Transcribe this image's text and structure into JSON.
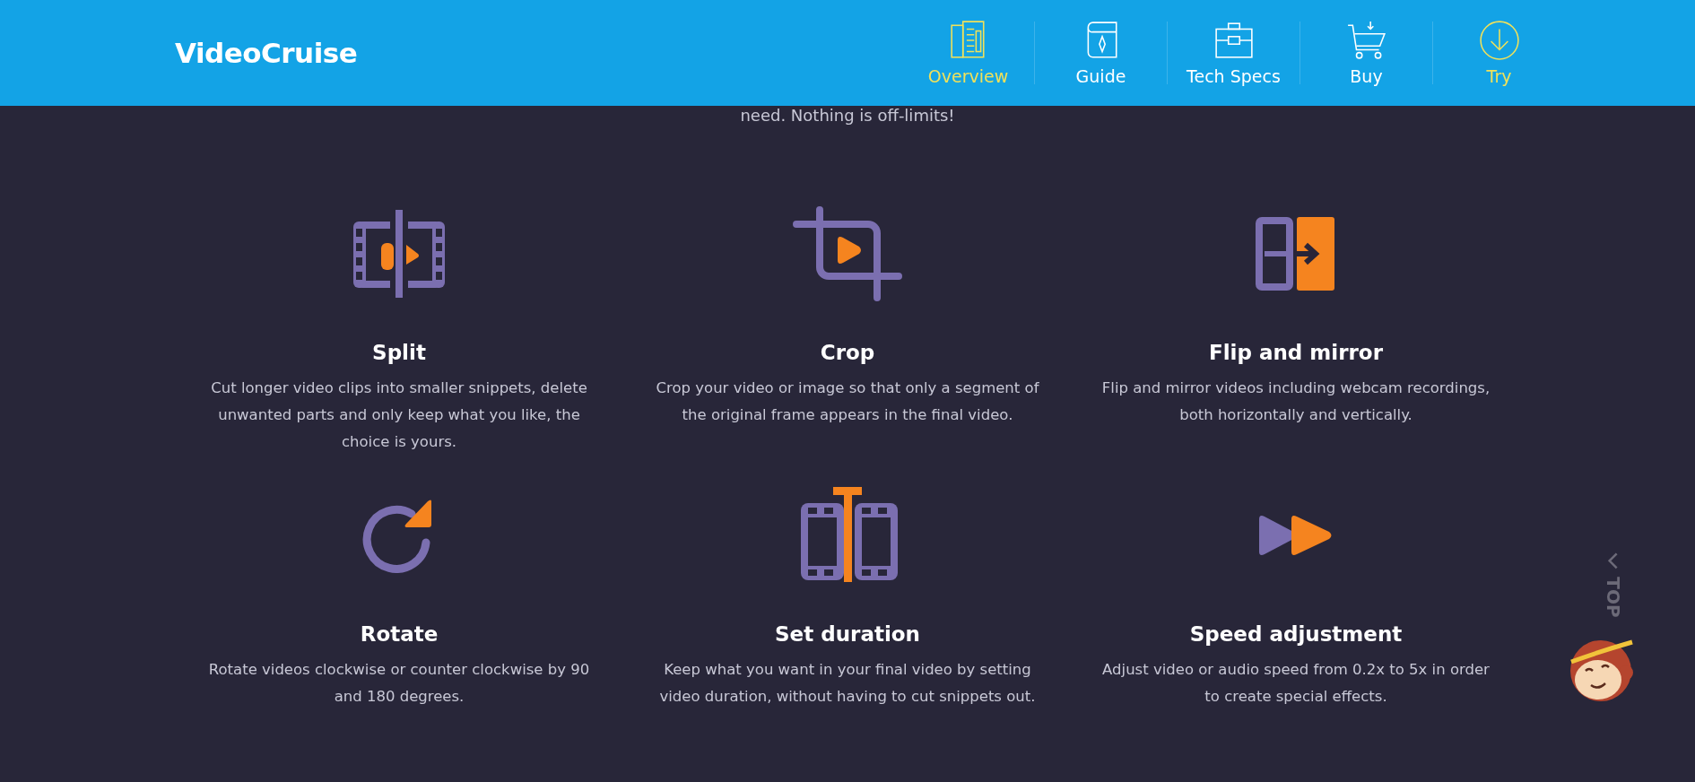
{
  "header": {
    "logo": "VideoCruise",
    "nav": [
      {
        "label": "Overview",
        "kind": "overview",
        "highlighted": true
      },
      {
        "label": "Guide",
        "kind": "guide",
        "highlighted": false
      },
      {
        "label": "Tech Specs",
        "kind": "specs",
        "highlighted": false
      },
      {
        "label": "Buy",
        "kind": "buy",
        "highlighted": false
      },
      {
        "label": "Try",
        "kind": "try",
        "highlighted": true
      }
    ]
  },
  "intro_tail": "need. Nothing is off-limits!",
  "features": [
    {
      "kind": "split",
      "title": "Split",
      "description": "Cut longer video clips into smaller snippets, delete unwanted parts and only keep what you like, the choice is yours."
    },
    {
      "kind": "crop",
      "title": "Crop",
      "description": "Crop your video or image so that only a segment of the original frame appears in the final video."
    },
    {
      "kind": "flip",
      "title": "Flip and mirror",
      "description": "Flip and mirror videos including webcam recordings, both horizontally and vertically."
    },
    {
      "kind": "rotate",
      "title": "Rotate",
      "description": "Rotate videos clockwise or counter clockwise by 90 and 180 degrees."
    },
    {
      "kind": "duration",
      "title": "Set duration",
      "description": "Keep what you want in your final video by setting video duration, without having to cut snippets out."
    },
    {
      "kind": "speed",
      "title": "Speed adjustment",
      "description": "Adjust video or audio speed from 0.2x to 5x in order to create special effects."
    }
  ],
  "back_to_top": {
    "label": "TOP"
  }
}
